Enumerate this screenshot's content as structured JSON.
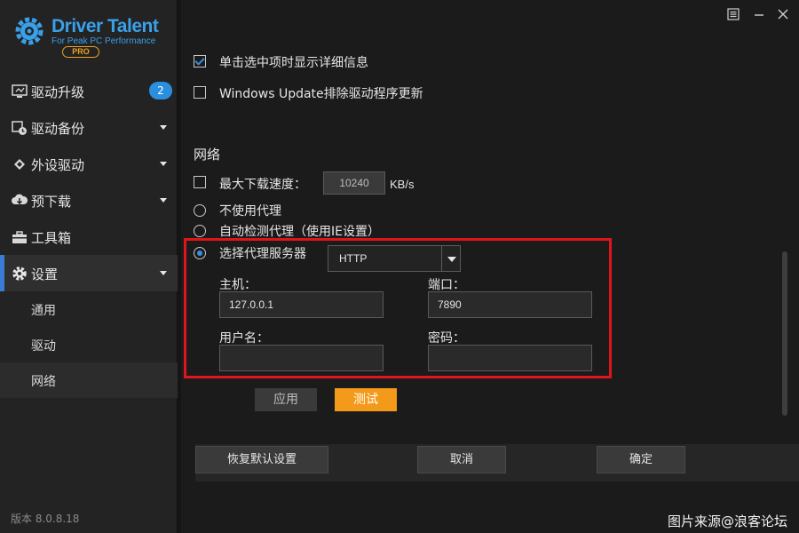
{
  "logo": {
    "title": "Driver Talent",
    "subtitle": "For Peak PC Performance",
    "edition": "PRO"
  },
  "sidebar": {
    "items": [
      {
        "label": "驱动升级",
        "badge": "2"
      },
      {
        "label": "驱动备份"
      },
      {
        "label": "外设驱动"
      },
      {
        "label": "预下载"
      },
      {
        "label": "工具箱"
      },
      {
        "label": "设置"
      }
    ],
    "sub_items": [
      {
        "label": "通用"
      },
      {
        "label": "驱动"
      },
      {
        "label": "网络"
      }
    ],
    "version": "版本 8.0.8.18"
  },
  "window": {
    "menu_icon": "menu-icon",
    "minimize_icon": "minimize-icon",
    "close_icon": "close-icon"
  },
  "settings": {
    "click_show_details": "单击选中项时显示详细信息",
    "exclude_windows_update": "Windows Update排除驱动程序更新",
    "network_heading": "网络",
    "max_speed_label": "最大下载速度：",
    "max_speed_value": "10240",
    "max_speed_unit": "KB/s",
    "no_proxy": "不使用代理",
    "auto_proxy": "自动检测代理（使用IE设置）",
    "manual_proxy": "选择代理服务器",
    "proxy_type": "HTTP",
    "host_label": "主机：",
    "host_value": "127.0.0.1",
    "port_label": "端口：",
    "port_value": "7890",
    "username_label": "用户名：",
    "username_value": "",
    "password_label": "密码：",
    "password_value": "",
    "apply_label": "应用",
    "test_label": "测试"
  },
  "footer": {
    "restore_label": "恢复默认设置",
    "cancel_label": "取消",
    "ok_label": "确定"
  },
  "watermark": "图片来源@浪客论坛",
  "colors": {
    "accent_blue": "#3a8fe0",
    "orange": "#f39a1a",
    "highlight_red": "#e0151b"
  }
}
